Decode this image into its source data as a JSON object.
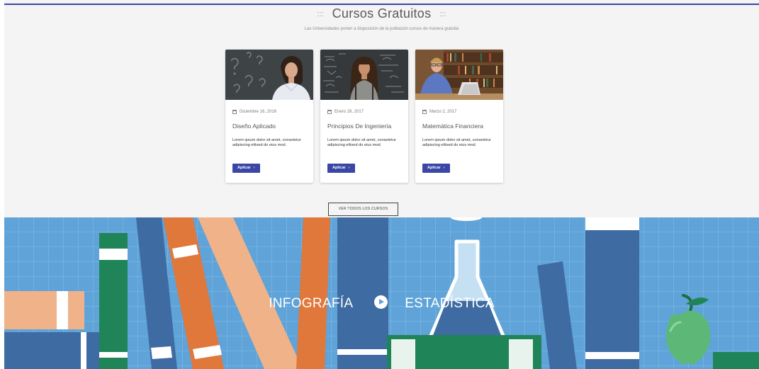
{
  "section": {
    "title": "Cursos Gratuitos",
    "deco": ":::",
    "subtitle": "Las Universidades ponen a disposición de la población cursos de manera gratuita"
  },
  "courses": [
    {
      "date": "Diciembre 16, 2016",
      "title": "Diseño Aplicado",
      "description": "Lorem ipsum dolor sit amet, consetetur adipiscing elitsed do eius mod.",
      "button": "Aplicar",
      "photo": "woman-chalkboard-photo"
    },
    {
      "date": "Enero 28, 2017",
      "title": "Principios De Ingeniería",
      "description": "Lorem ipsum dolor sit amet, consetetur adipiscing elitsed do eius mod.",
      "button": "Aplicar",
      "photo": "student-chalkboard-photo"
    },
    {
      "date": "Marzo 2, 2017",
      "title": "Matemática Financiera",
      "description": "Lorem ipsum dolor sit amet, consetetur adipiscing elitsed do eius mod.",
      "button": "Aplicar",
      "photo": "student-library-photo"
    }
  ],
  "all_courses_button": "VER TODOS LOS CURSOS",
  "hero": {
    "left_label": "INFOGRAFÍA",
    "right_label": "ESTADÍSTICA",
    "play_icon": "play-circle-icon"
  },
  "colors": {
    "accent": "#3a47a6",
    "hero_bg": "#5fa3d8"
  }
}
